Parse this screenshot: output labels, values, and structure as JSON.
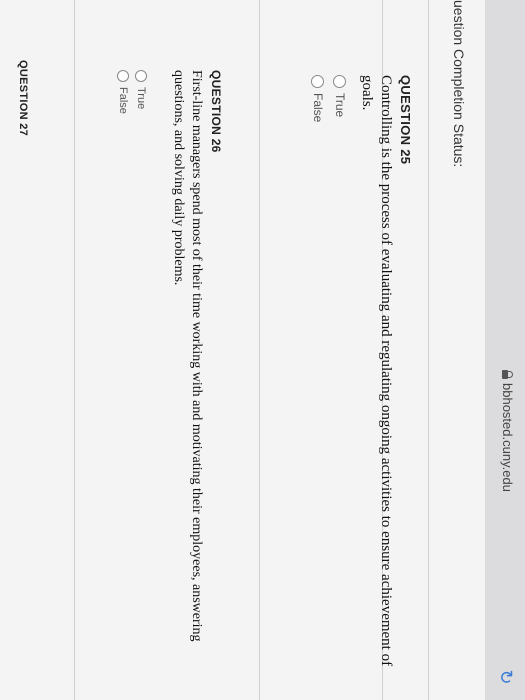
{
  "browser": {
    "url": "bbhosted.cuny.edu"
  },
  "header": {
    "status_label": "uestion Completion Status:"
  },
  "questions": [
    {
      "title": "QUESTION 25",
      "text_line1": "Controlling is the process of evaluating and regulating ongoing activities to ensure achievement of",
      "text_line2": "goals.",
      "options": [
        "True",
        "False"
      ]
    },
    {
      "title": "QUESTION 26",
      "text_line1": "First-line managers spend most of their time working with and motivating their employees, answering",
      "text_line2": "questions, and solving daily problems.",
      "options": [
        "True",
        "False"
      ]
    },
    {
      "title": "QUESTION 27"
    }
  ]
}
